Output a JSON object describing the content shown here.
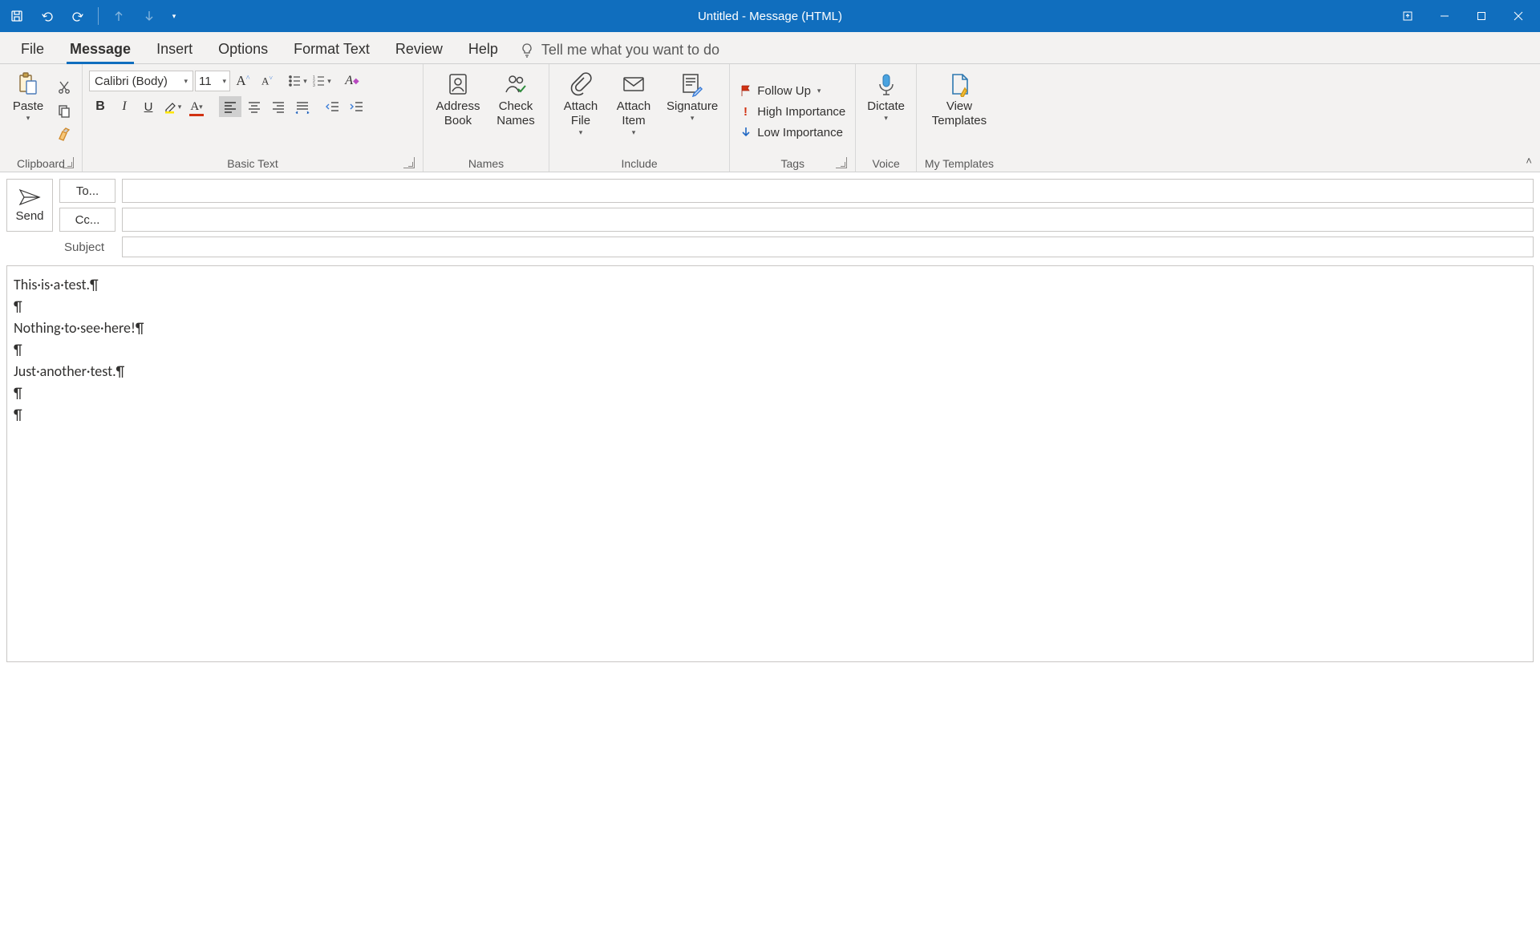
{
  "window": {
    "title": "Untitled  -  Message (HTML)"
  },
  "tabs": {
    "file": "File",
    "message": "Message",
    "insert": "Insert",
    "options": "Options",
    "format_text": "Format Text",
    "review": "Review",
    "help": "Help",
    "tellme": "Tell me what you want to do"
  },
  "ribbon": {
    "clipboard": {
      "paste": "Paste",
      "label": "Clipboard"
    },
    "basic_text": {
      "font_name": "Calibri (Body)",
      "font_size": "11",
      "label": "Basic Text"
    },
    "names": {
      "address_book": "Address Book",
      "check_names": "Check Names",
      "label": "Names"
    },
    "include": {
      "attach_file": "Attach File",
      "attach_item": "Attach Item",
      "signature": "Signature",
      "label": "Include"
    },
    "tags": {
      "follow_up": "Follow Up",
      "high_importance": "High Importance",
      "low_importance": "Low Importance",
      "label": "Tags"
    },
    "voice": {
      "dictate": "Dictate",
      "label": "Voice"
    },
    "templates": {
      "view_templates": "View Templates",
      "label": "My Templates"
    }
  },
  "message_header": {
    "send": "Send",
    "to": "To...",
    "cc": "Cc...",
    "subject": "Subject",
    "to_value": "",
    "cc_value": "",
    "subject_value": ""
  },
  "body_lines": [
    "This·is·a·test.¶",
    "¶",
    "Nothing·to·see·here!¶",
    "¶",
    "Just·another·test.¶",
    "¶",
    "¶"
  ]
}
